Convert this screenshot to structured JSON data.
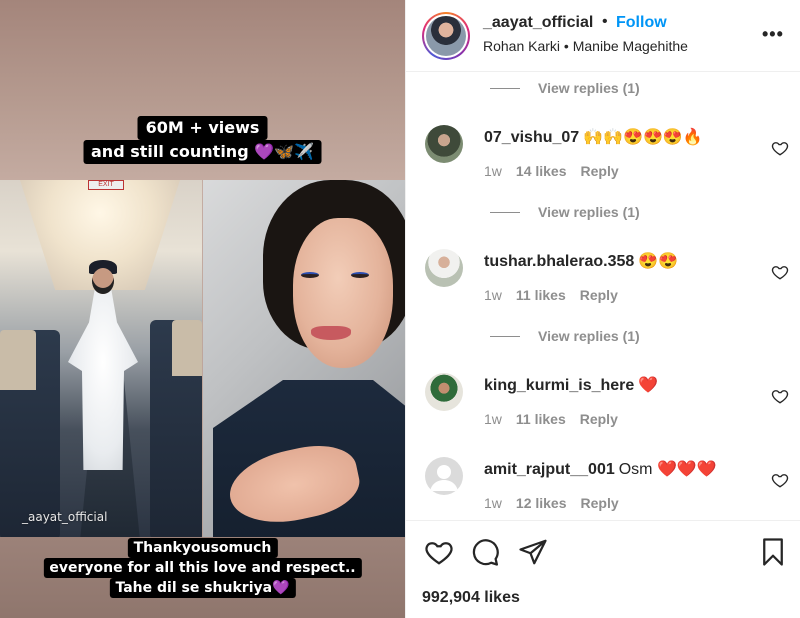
{
  "media": {
    "caption_top": [
      "60M + views",
      "and still counting 💜🦋✈️"
    ],
    "caption_bottom": [
      "Thankyousomuch",
      "everyone for all this love and respect..",
      "Tahe dil se shukriya💜"
    ],
    "watermark": "_aayat_official",
    "exit_sign": "EXIT"
  },
  "header": {
    "username": "_aayat_official",
    "separator": "•",
    "follow_label": "Follow",
    "subtitle": "Rohan Karki • Manibe Magehithe",
    "more_label": "•••"
  },
  "comments": {
    "view_replies_label": "View replies (1)",
    "items": [
      {
        "username": "07_vishu_07",
        "text": "🙌🙌😍😍😍🔥",
        "time": "1w",
        "likes": "14 likes",
        "reply": "Reply"
      },
      {
        "username": "tushar.bhalerao.358",
        "text": "😍😍",
        "time": "1w",
        "likes": "11 likes",
        "reply": "Reply"
      },
      {
        "username": "king_kurmi_is_here",
        "text": "❤️",
        "time": "1w",
        "likes": "11 likes",
        "reply": "Reply"
      },
      {
        "username": "amit_rajput__001",
        "text": "Osm ❤️❤️❤️",
        "time": "1w",
        "likes": "12 likes",
        "reply": "Reply"
      }
    ]
  },
  "actions": {
    "like_icon": "heart-icon",
    "comment_icon": "comment-icon",
    "share_icon": "share-icon",
    "save_icon": "bookmark-icon",
    "likes_count": "992,904 likes"
  },
  "colors": {
    "follow_blue": "#0095f6",
    "muted_gray": "#8e8e8e",
    "text_dark": "#262626"
  }
}
